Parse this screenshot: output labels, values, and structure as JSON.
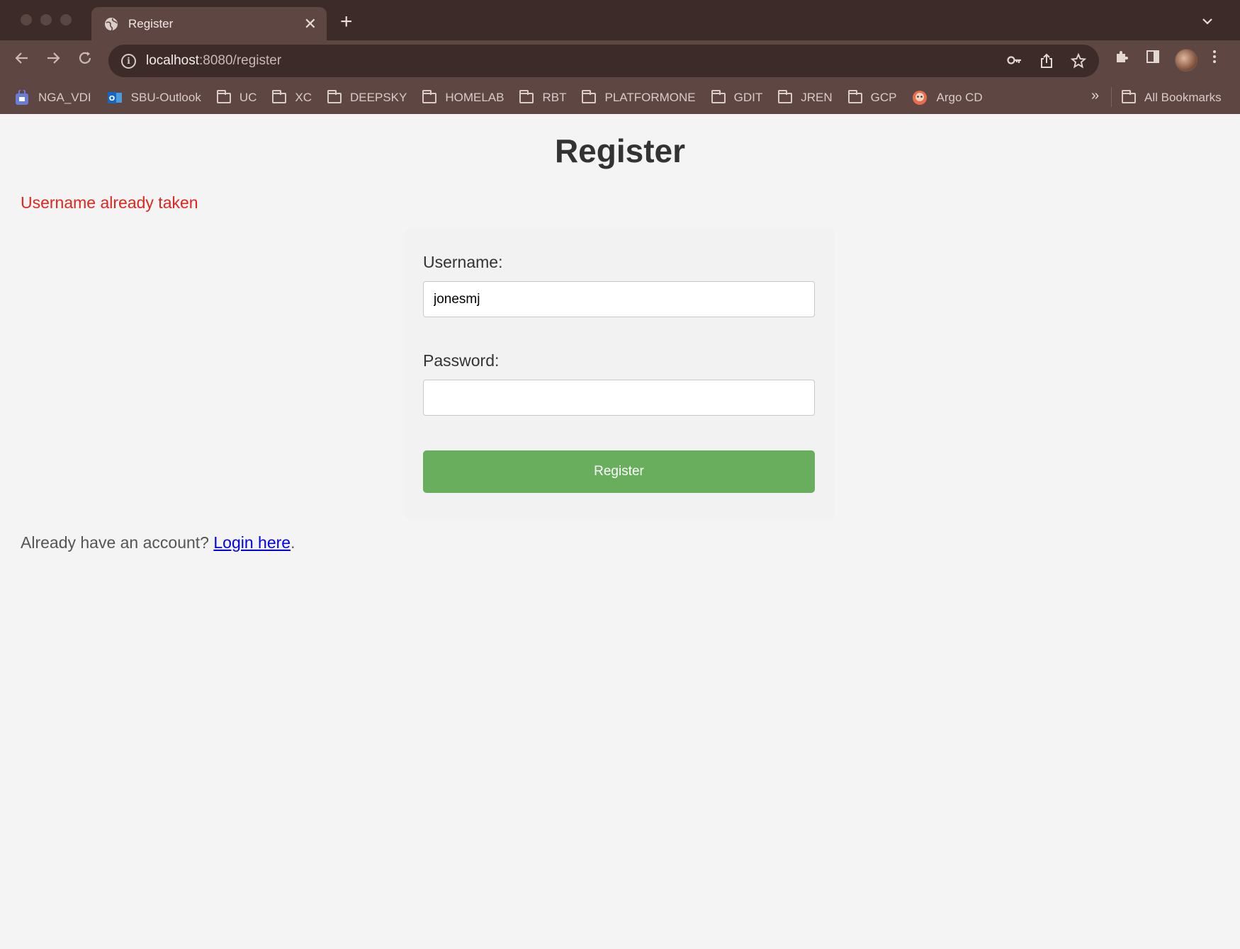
{
  "browser": {
    "tab_title": "Register",
    "tab_close_glyph": "✕",
    "new_tab_glyph": "+",
    "url_host": "localhost",
    "url_rest": ":8080/register",
    "bookmarks": [
      {
        "label": "NGA_VDI",
        "icon": "vdi-icon"
      },
      {
        "label": "SBU-Outlook",
        "icon": "outlook-icon"
      },
      {
        "label": "UC",
        "icon": "folder-icon"
      },
      {
        "label": "XC",
        "icon": "folder-icon"
      },
      {
        "label": "DEEPSKY",
        "icon": "folder-icon"
      },
      {
        "label": "HOMELAB",
        "icon": "folder-icon"
      },
      {
        "label": "RBT",
        "icon": "folder-icon"
      },
      {
        "label": "PLATFORMONE",
        "icon": "folder-icon"
      },
      {
        "label": "GDIT",
        "icon": "folder-icon"
      },
      {
        "label": "JREN",
        "icon": "folder-icon"
      },
      {
        "label": "GCP",
        "icon": "folder-icon"
      },
      {
        "label": "Argo CD",
        "icon": "argo-icon"
      }
    ],
    "more_bookmarks_glyph": "»",
    "all_bookmarks_label": "All Bookmarks"
  },
  "page": {
    "title": "Register",
    "error": "Username already taken",
    "username_label": "Username:",
    "username_value": "jonesmj",
    "password_label": "Password:",
    "password_value": "",
    "submit_label": "Register",
    "footer_prefix": "Already have an account? ",
    "footer_link": "Login here",
    "footer_suffix": "."
  },
  "colors": {
    "accent_button": "#68ae5d",
    "error_text": "#e0261f",
    "link": "#0000ee",
    "chrome_bg": "#5e4642"
  }
}
